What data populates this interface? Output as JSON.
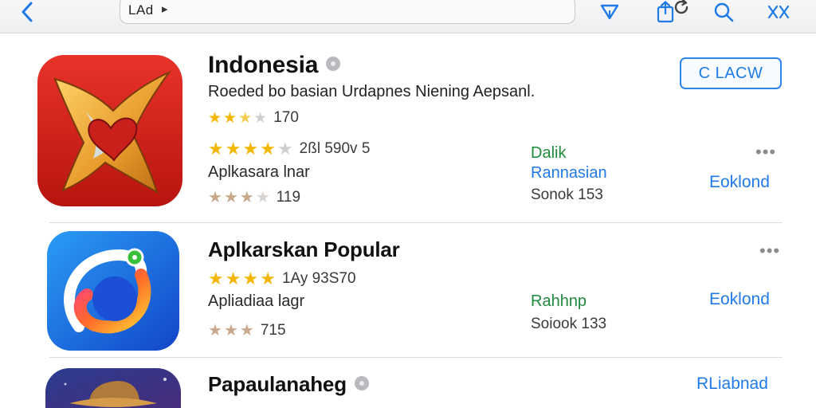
{
  "toolbar": {
    "address_text": "LAd",
    "address_caret": "▸",
    "icons": [
      "back-chevron-icon",
      "reload-icon",
      "send-icon",
      "share-icon",
      "search-icon",
      "close-tabs-icon"
    ]
  },
  "colors": {
    "accent_blue": "#1f7ae8",
    "status_green": "#1f8a3c",
    "star_gold": "#f2b705"
  },
  "apps": [
    {
      "title": "Indonesia",
      "description": "Roeded bo basian Urdapnes Niening Aepsanl.",
      "rating_small_text": "170",
      "rating_main_text": "2ßl 590v 5",
      "category": "Aplkasara lnar",
      "rating_tan_text": "119",
      "side_green": "Dalik",
      "side_blue": "Rannasian",
      "side_gray": "Sonok 153",
      "primary_button": "C LACW",
      "action": "Eoklond",
      "more": "•••"
    },
    {
      "title": "Aplkarskan Popular",
      "rating_main_text": "1Ay 93S70",
      "category": "Apliadiaa lagr",
      "rating_tan_text": "715",
      "side_green": "Rahhnp",
      "side_gray": "Soiook 133",
      "action": "Eoklond",
      "more": "•••"
    },
    {
      "title": "Papaulanaheg",
      "action": "RLiabnad"
    }
  ]
}
